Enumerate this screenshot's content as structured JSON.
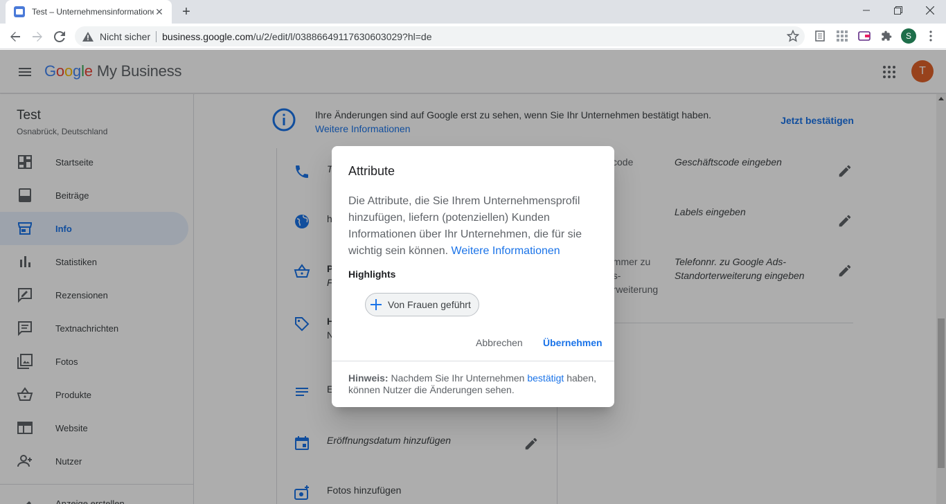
{
  "browser": {
    "tab_title": "Test – Unternehmensinformationen",
    "tab_close": "✕",
    "new_tab": "+",
    "insecure_label": "Nicht sicher",
    "url_host": "business.google.com",
    "url_path": "/u/2/edit/l/03886649117630603029?hl=de",
    "profile_initial": "S"
  },
  "app": {
    "logo": {
      "google": [
        "G",
        "o",
        "o",
        "g",
        "l",
        "e"
      ],
      "product": "My Business"
    },
    "avatar_initial": "T"
  },
  "sidebar": {
    "business_name": "Test",
    "business_location": "Osnabrück, Deutschland",
    "items": [
      {
        "label": "Startseite",
        "icon": "dashboard-icon",
        "active": false
      },
      {
        "label": "Beiträge",
        "icon": "posts-icon",
        "active": false
      },
      {
        "label": "Info",
        "icon": "storefront-icon",
        "active": true
      },
      {
        "label": "Statistiken",
        "icon": "bar-chart-icon",
        "active": false
      },
      {
        "label": "Rezensionen",
        "icon": "rate-review-icon",
        "active": false
      },
      {
        "label": "Textnachrichten",
        "icon": "message-icon",
        "active": false
      },
      {
        "label": "Fotos",
        "icon": "photo-library-icon",
        "active": false
      },
      {
        "label": "Produkte",
        "icon": "shopping-basket-icon",
        "active": false
      },
      {
        "label": "Website",
        "icon": "web-icon",
        "active": false
      },
      {
        "label": "Nutzer",
        "icon": "person-add-icon",
        "active": false
      }
    ],
    "peek_label": "Anzeige erstellen"
  },
  "notice": {
    "text": "Ihre Änderungen sind auf Google erst zu sehen, wenn Sie Ihr Unternehmen bestätigt haben.",
    "more_link": "Weitere Informationen",
    "confirm_link": "Jetzt bestätigen"
  },
  "left_rows": [
    {
      "icon": "phone-icon",
      "text": "T",
      "italic": true
    },
    {
      "icon": "globe-icon",
      "text": "h",
      "italic": false
    },
    {
      "icon": "basket-icon",
      "text": "P",
      "sub": "F",
      "italic": false
    },
    {
      "icon": "label-icon",
      "text": "H",
      "sub": "N",
      "italic": false
    },
    {
      "icon": "description-icon",
      "text": "E",
      "italic": false
    },
    {
      "icon": "event-icon",
      "text": "Eröffnungsdatum hinzufügen",
      "italic": true,
      "edit": true
    },
    {
      "icon": "add-photo-icon",
      "text": "Fotos hinzufügen",
      "italic": false
    }
  ],
  "right_rows": [
    {
      "key": "scode",
      "value": "Geschäftscode eingeben"
    },
    {
      "key": "",
      "value": "Labels eingeben"
    },
    {
      "key": "ummer zu\nds-\nerweiterung",
      "value": "Telefonnr. zu Google Ads-Standorterweiterung eingeben"
    }
  ],
  "dialog": {
    "title": "Attribute",
    "body": "Die Attribute, die Sie Ihrem Unternehmensprofil hinzufügen, liefern (potenziellen) Kunden Informationen über Ihr Unternehmen, die für sie wichtig sein können.",
    "body_link": "Weitere Informationen",
    "section_title": "Highlights",
    "chip_label": "Von Frauen geführt",
    "cancel_label": "Abbrechen",
    "apply_label": "Übernehmen",
    "hint_bold": "Hinweis:",
    "hint_pre": "Nachdem Sie Ihr Unternehmen",
    "hint_link": "bestätigt",
    "hint_post": "haben, können Nutzer die Änderungen sehen."
  },
  "colors": {
    "accent": "#1a73e8",
    "active_bg": "#e8f0fe",
    "avatar": "#e0622a",
    "scrim": "rgba(0,0,0,0.32)"
  }
}
